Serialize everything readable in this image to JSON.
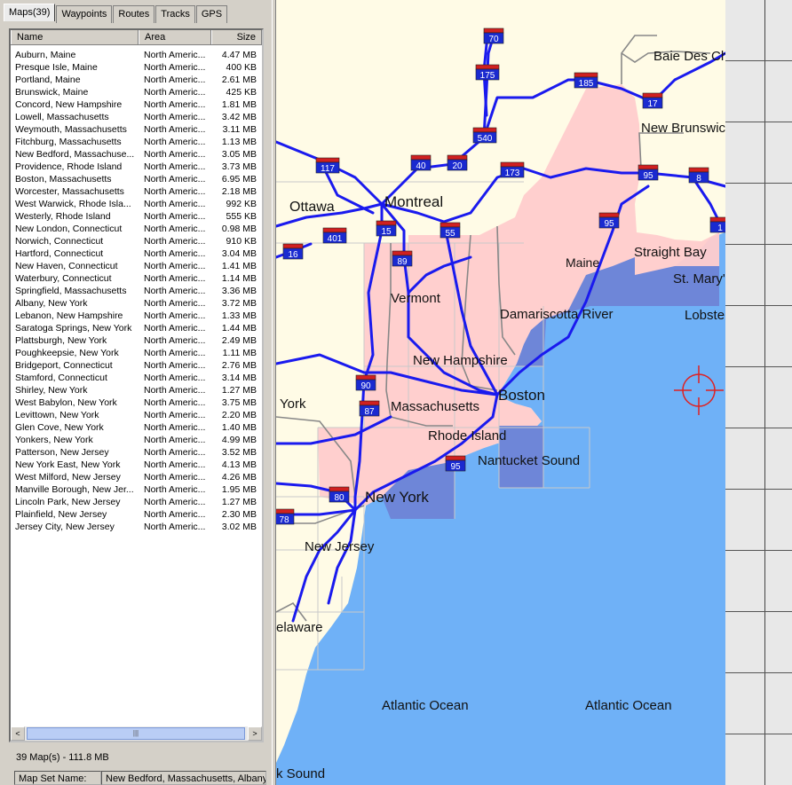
{
  "tabs": [
    "Maps(39)",
    "Waypoints",
    "Routes",
    "Tracks",
    "GPS"
  ],
  "list": {
    "headers": {
      "name": "Name",
      "area": "Area",
      "size": "Size"
    },
    "rows": [
      [
        "Auburn, Maine",
        "North Americ...",
        "4.47 MB"
      ],
      [
        "Presque Isle, Maine",
        "North Americ...",
        "400 KB"
      ],
      [
        "Portland, Maine",
        "North Americ...",
        "2.61 MB"
      ],
      [
        "Brunswick, Maine",
        "North Americ...",
        "425 KB"
      ],
      [
        "Concord, New Hampshire",
        "North Americ...",
        "1.81 MB"
      ],
      [
        "Lowell, Massachusetts",
        "North Americ...",
        "3.42 MB"
      ],
      [
        "Weymouth, Massachusetts",
        "North Americ...",
        "3.11 MB"
      ],
      [
        "Fitchburg, Massachusetts",
        "North Americ...",
        "1.13 MB"
      ],
      [
        "New Bedford, Massachuse...",
        "North Americ...",
        "3.05 MB"
      ],
      [
        "Providence, Rhode Island",
        "North Americ...",
        "3.73 MB"
      ],
      [
        "Boston, Massachusetts",
        "North Americ...",
        "6.95 MB"
      ],
      [
        "Worcester, Massachusetts",
        "North Americ...",
        "2.18 MB"
      ],
      [
        "West Warwick, Rhode Isla...",
        "North Americ...",
        "992 KB"
      ],
      [
        "Westerly, Rhode Island",
        "North Americ...",
        "555 KB"
      ],
      [
        "New London, Connecticut",
        "North Americ...",
        "0.98 MB"
      ],
      [
        "Norwich, Connecticut",
        "North Americ...",
        "910 KB"
      ],
      [
        "Hartford, Connecticut",
        "North Americ...",
        "3.04 MB"
      ],
      [
        "New Haven, Connecticut",
        "North Americ...",
        "1.41 MB"
      ],
      [
        "Waterbury, Connecticut",
        "North Americ...",
        "1.14 MB"
      ],
      [
        "Springfield, Massachusetts",
        "North Americ...",
        "3.36 MB"
      ],
      [
        "Albany, New York",
        "North Americ...",
        "3.72 MB"
      ],
      [
        "Lebanon, New Hampshire",
        "North Americ...",
        "1.33 MB"
      ],
      [
        "Saratoga Springs, New York",
        "North Americ...",
        "1.44 MB"
      ],
      [
        "Plattsburgh, New York",
        "North Americ...",
        "2.49 MB"
      ],
      [
        "Poughkeepsie, New York",
        "North Americ...",
        "1.11 MB"
      ],
      [
        "Bridgeport, Connecticut",
        "North Americ...",
        "2.76 MB"
      ],
      [
        "Stamford, Connecticut",
        "North Americ...",
        "3.14 MB"
      ],
      [
        "Shirley, New York",
        "North Americ...",
        "1.27 MB"
      ],
      [
        "West Babylon, New York",
        "North Americ...",
        "3.75 MB"
      ],
      [
        "Levittown, New York",
        "North Americ...",
        "2.20 MB"
      ],
      [
        "Glen Cove, New York",
        "North Americ...",
        "1.40 MB"
      ],
      [
        "Yonkers, New York",
        "North Americ...",
        "4.99 MB"
      ],
      [
        "Patterson, New Jersey",
        "North Americ...",
        "3.52 MB"
      ],
      [
        "New York East, New York",
        "North Americ...",
        "4.13 MB"
      ],
      [
        "West Milford, New Jersey",
        "North Americ...",
        "4.26 MB"
      ],
      [
        "Manville Borough, New Jer...",
        "North Americ...",
        "1.95 MB"
      ],
      [
        "Lincoln Park, New Jersey",
        "North Americ...",
        "1.27 MB"
      ],
      [
        "Plainfield, New Jersey",
        "North Americ...",
        "2.30 MB"
      ],
      [
        "Jersey City, New Jersey",
        "North Americ...",
        "3.02 MB"
      ]
    ]
  },
  "scroll": {
    "left": "<",
    "right": ">",
    "thumb": "|||"
  },
  "summary": "39 Map(s) - 111.8 MB",
  "status": {
    "label": "Map Set Name:",
    "value": "New Bedford, Massachusetts, Albany,"
  },
  "map": {
    "place_labels": [
      "Baie Des Chaleurs",
      "New Brunswick",
      "Ottawa",
      "Montreal",
      "Maine",
      "Straight Bay",
      "St. Mary's Bay",
      "Lobster Bay",
      "Vermont",
      "Damariscotta River",
      "New Hampshire",
      "Boston",
      "York",
      "Massachusetts",
      "Rhode Island",
      "Nantucket Sound",
      "New York",
      "New Jersey",
      "elaware",
      "Atlantic Ocean",
      "Atlantic Ocean",
      "k Sound"
    ],
    "shields": [
      "70",
      "175",
      "185",
      "17",
      "540",
      "117",
      "40",
      "20",
      "173",
      "95",
      "8",
      "401",
      "15",
      "55",
      "95",
      "1",
      "16",
      "89",
      "90",
      "87",
      "95",
      "80",
      "78"
    ],
    "colors": {
      "land": "#fffbe6",
      "water": "#6fb1f7",
      "coverage": "#ffcccc",
      "coverage_water": "#6e86d8",
      "roads": "#1a1aee",
      "borders": "#888888"
    }
  }
}
